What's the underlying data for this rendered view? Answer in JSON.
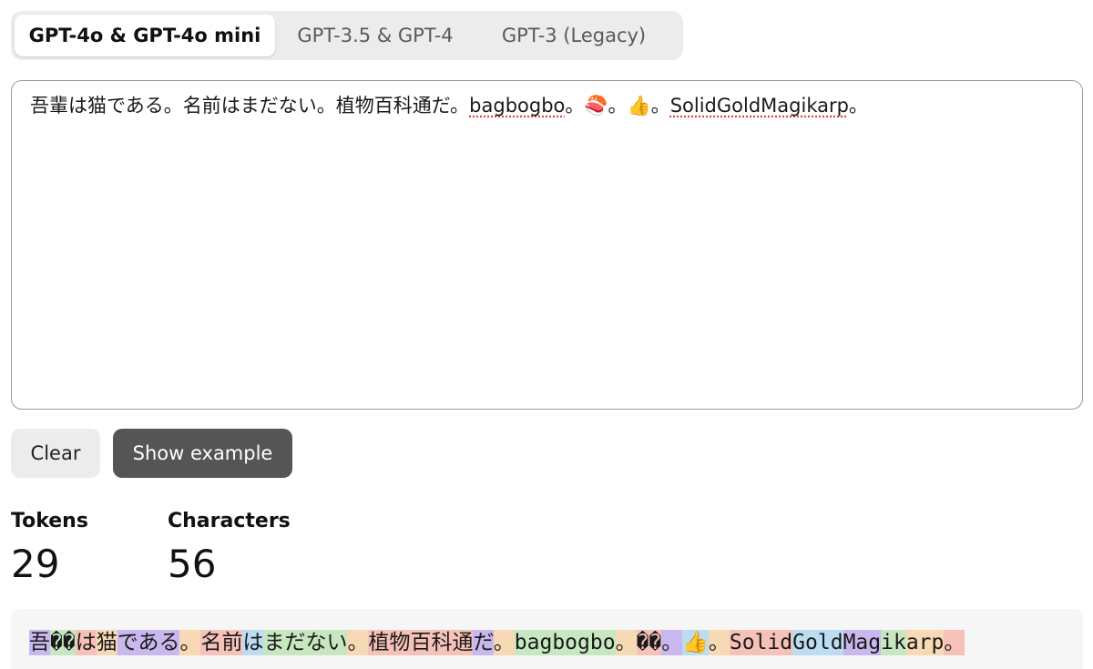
{
  "tabs": [
    {
      "label": "GPT-4o & GPT-4o mini",
      "active": true
    },
    {
      "label": "GPT-3.5 & GPT-4",
      "active": false
    },
    {
      "label": "GPT-3 (Legacy)",
      "active": false
    }
  ],
  "input": {
    "text_plain": "吾輩は猫である。名前はまだない。植物百科通だ。",
    "word1": "bagbogbo",
    "sep1": "。",
    "emoji1": "🍣",
    "sep2": "。",
    "emoji2": "👍",
    "sep3": "。",
    "word2": "SolidGoldMagikarp",
    "end": "。"
  },
  "buttons": {
    "clear": "Clear",
    "show_example": "Show example"
  },
  "stats": {
    "tokens_label": "Tokens",
    "tokens_value": "29",
    "characters_label": "Characters",
    "characters_value": "56"
  },
  "tokens": [
    {
      "text": "吾",
      "color": "#c9b8ef"
    },
    {
      "text": "��",
      "color": "#c7e7c0"
    },
    {
      "text": "は",
      "color": "#f6c2b8"
    },
    {
      "text": "猫",
      "color": "#f7d9b5"
    },
    {
      "text": "で",
      "color": "#c9b8ef"
    },
    {
      "text": "ある",
      "color": "#c9b8ef"
    },
    {
      "text": "。",
      "color": "#f7d9b5"
    },
    {
      "text": "名",
      "color": "#f6c2b8"
    },
    {
      "text": "前",
      "color": "#f6c2b8"
    },
    {
      "text": "は",
      "color": "#bcdcf2"
    },
    {
      "text": "まだ",
      "color": "#c7e7c0"
    },
    {
      "text": "ない",
      "color": "#c7e7c0"
    },
    {
      "text": "。",
      "color": "#f7d9b5"
    },
    {
      "text": "植物",
      "color": "#f6c2b8"
    },
    {
      "text": "百",
      "color": "#f6c2b8"
    },
    {
      "text": "科",
      "color": "#f6c2b8"
    },
    {
      "text": "通",
      "color": "#f6c2b8"
    },
    {
      "text": "だ",
      "color": "#c9b8ef"
    },
    {
      "text": "。",
      "color": "#f7d9b5"
    },
    {
      "text": "bagbogbo",
      "color": "#c7e7c0"
    },
    {
      "text": "。",
      "color": "#f7d9b5"
    },
    {
      "text": "��",
      "color": "#f6c2b8"
    },
    {
      "text": "。",
      "color": "#c9b8ef"
    },
    {
      "text": "👍",
      "color": "#bcdcf2"
    },
    {
      "text": "。",
      "color": "#f7d9b5"
    },
    {
      "text": "Solid",
      "color": "#f6c2b8"
    },
    {
      "text": "Gold",
      "color": "#bcdcf2"
    },
    {
      "text": "Mag",
      "color": "#c9b8ef"
    },
    {
      "text": "ik",
      "color": "#c7e7c0"
    },
    {
      "text": "arp",
      "color": "#f7d9b5"
    },
    {
      "text": "。",
      "color": "#f6c2b8"
    }
  ]
}
